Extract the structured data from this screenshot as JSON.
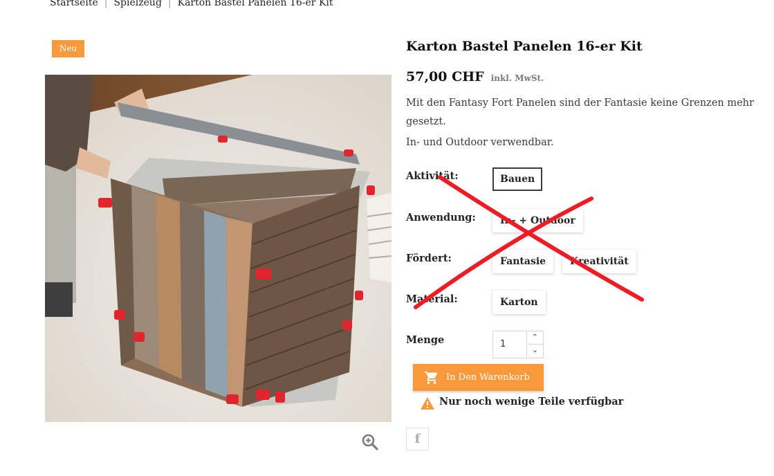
{
  "breadcrumb": [
    "Startseite",
    "Spielzeug",
    "Karton Bastel Panelen 16-er Kit"
  ],
  "badge": "Neu",
  "product": {
    "title": "Karton Bastel Panelen 16-er Kit",
    "price": "57,00 CHF",
    "tax_note": "inkl. MwSt.",
    "description": [
      "Mit den Fantasy Fort Panelen sind der Fantasie keine Grenzen mehr gesetzt.",
      "In- und Outdoor verwendbar."
    ]
  },
  "attributes": {
    "aktivitaet": {
      "label": "Aktivität:",
      "values": [
        "Bauen"
      ]
    },
    "anwendung": {
      "label": "Anwendung:",
      "values": [
        "In- + Outdoor"
      ]
    },
    "foerdert": {
      "label": "Fördert:",
      "values": [
        "Fantasie",
        "Kreativität"
      ]
    },
    "material": {
      "label": "Material:",
      "values": [
        "Karton"
      ]
    }
  },
  "quantity": {
    "label": "Menge",
    "value": "1"
  },
  "cart_button": "In Den Warenkorb",
  "stock_notice": "Nur noch wenige Teile verfügbar",
  "share": {
    "facebook_glyph": "f"
  },
  "colors": {
    "accent": "#f89a3c",
    "overlay_x": "#ee1c25"
  }
}
